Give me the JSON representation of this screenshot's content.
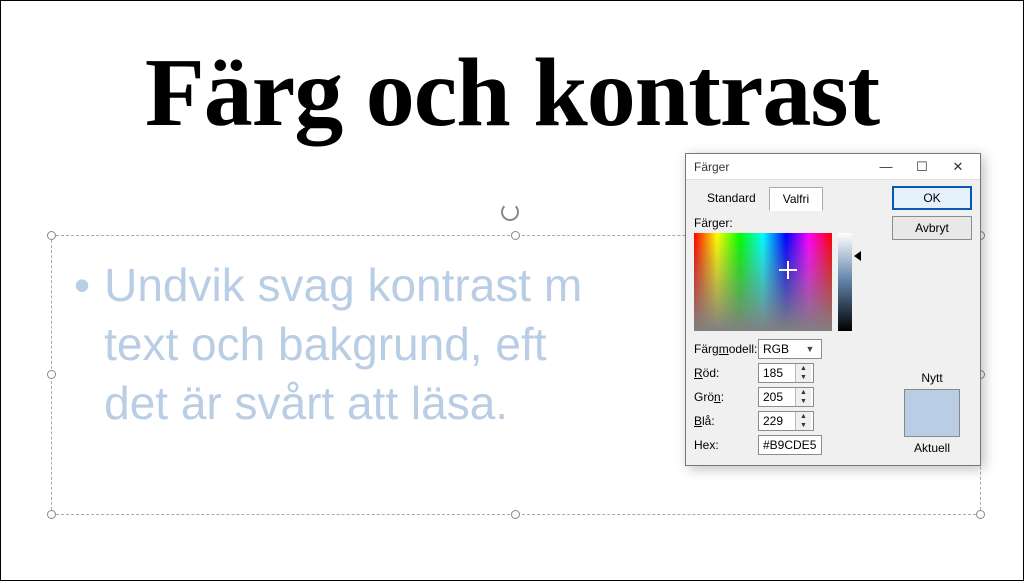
{
  "slide": {
    "title": "Färg och kontrast",
    "bullet_text": "Undvik svag kontrast mellan text och bakgrund, eftersom det är svårt att läsa.",
    "bullet_visible": "Undvik svag kontrast m\ntext och bakgrund, eft\ndet är svårt att läsa.",
    "text_color": "#B9CDE5"
  },
  "dialog": {
    "title": "Färger",
    "tabs": {
      "standard": "Standard",
      "custom": "Valfri"
    },
    "buttons": {
      "ok": "OK",
      "cancel": "Avbryt"
    },
    "labels": {
      "colors": "Färger:",
      "model": "Färgmodell:",
      "red": "Röd:",
      "green": "Grön:",
      "blue": "Blå:",
      "hex": "Hex:",
      "new": "Nytt",
      "current": "Aktuell"
    },
    "values": {
      "model": "RGB",
      "red": "185",
      "green": "205",
      "blue": "229",
      "hex": "#B9CDE5"
    },
    "swatch_color": "#B9CDE5"
  }
}
